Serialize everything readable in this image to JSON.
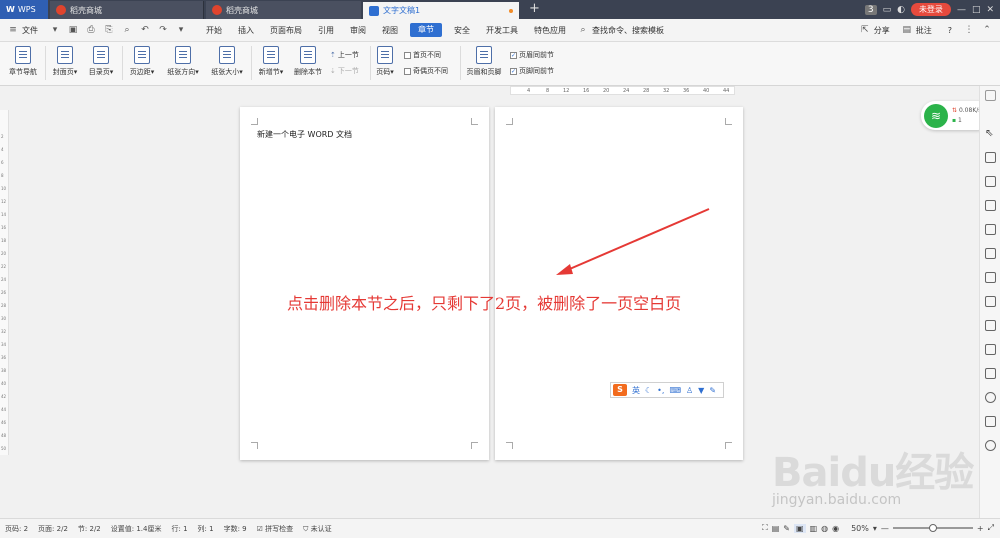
{
  "tabs": [
    {
      "label": "WPS"
    },
    {
      "label": "稻壳商城"
    },
    {
      "label": "稻壳商城"
    },
    {
      "label": "文字文稿1"
    }
  ],
  "window": {
    "page_count_badge": "3",
    "login_label": "未登录"
  },
  "menu": {
    "file": "文件",
    "items": [
      "开始",
      "插入",
      "页面布局",
      "引用",
      "审阅",
      "视图",
      "章节",
      "安全",
      "开发工具",
      "特色应用"
    ],
    "search": "查找命令、搜索模板",
    "share": "分享",
    "comment": "批注",
    "help": "?"
  },
  "ribbon": {
    "buttons": [
      "章节导航",
      "封面页",
      "目录页",
      "页边距",
      "纸张方向",
      "纸张大小",
      "新增节",
      "删除本节",
      "页码",
      "页眉和页脚"
    ],
    "prev_section": "上一节",
    "next_section": "下一节",
    "checks": [
      {
        "label": "首页不同",
        "checked": false
      },
      {
        "label": "奇偶页不同",
        "checked": false
      },
      {
        "label": "页眉同前节",
        "checked": true
      },
      {
        "label": "页脚同前节",
        "checked": true
      }
    ]
  },
  "ruler": {
    "ticks": [
      "4",
      "8",
      "12",
      "16",
      "20",
      "24",
      "28",
      "32",
      "36",
      "40",
      "44"
    ]
  },
  "vruler": {
    "ticks": [
      "2",
      "4",
      "6",
      "8",
      "10",
      "12",
      "14",
      "16",
      "18",
      "20",
      "22",
      "24",
      "26",
      "28",
      "30",
      "32",
      "34",
      "36",
      "38",
      "40",
      "42",
      "44",
      "46",
      "48",
      "50"
    ]
  },
  "document": {
    "text": "新建一个电子 WORD 文档"
  },
  "annotation": "点击删除本节之后，只剩下了2页，被删除了一页空白页",
  "ime": {
    "logo": "S",
    "mode": "英"
  },
  "network": {
    "speed": "0.08K/s",
    "count": "1"
  },
  "watermark": {
    "brand": "Baidu经验",
    "url": "jingyan.baidu.com"
  },
  "status": {
    "page": "页码: 2",
    "pages": "页面: 2/2",
    "section": "节: 2/2",
    "setting": "设置值: 1.4厘米",
    "row": "行: 1",
    "col": "列: 1",
    "chars": "字数: 9",
    "spell": "拼写检查",
    "cert": "未认证",
    "zoom": "50%",
    "zoom_fraction": 0.5
  },
  "colors": {
    "accent": "#2f6fd1",
    "annotation": "#e53935",
    "arrow": "#e53935",
    "wifi": "#2bb34a"
  }
}
